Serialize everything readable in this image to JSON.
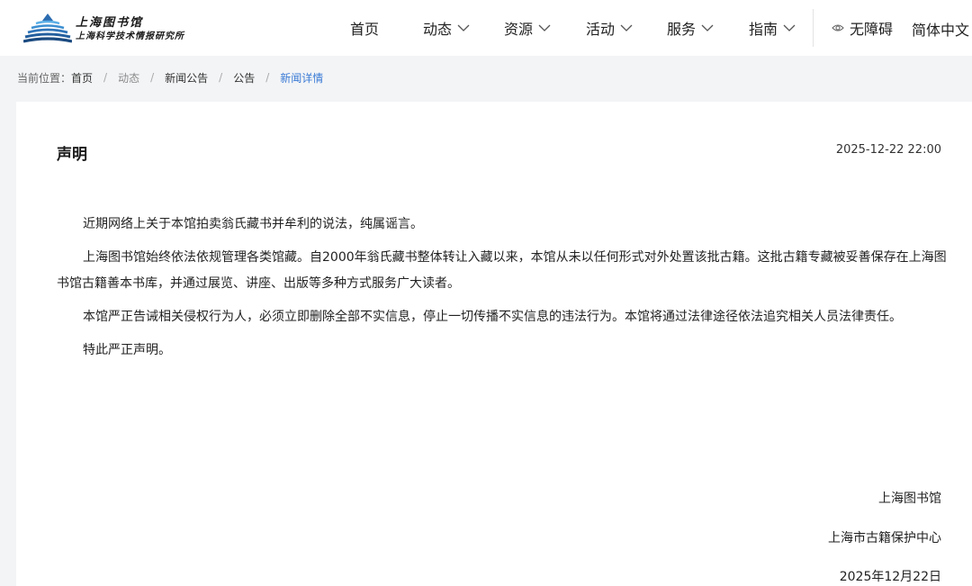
{
  "header": {
    "logo_name": "上海图书馆",
    "logo_subtitle": "上海科学技术情报研究所",
    "nav": [
      {
        "label": "首页",
        "has_dropdown": false
      },
      {
        "label": "动态",
        "has_dropdown": true
      },
      {
        "label": "资源",
        "has_dropdown": true
      },
      {
        "label": "活动",
        "has_dropdown": true
      },
      {
        "label": "服务",
        "has_dropdown": true
      },
      {
        "label": "指南",
        "has_dropdown": true
      }
    ],
    "accessibility_label": "无障碍",
    "language_label": "简体中文"
  },
  "breadcrumb": {
    "prefix": "当前位置：",
    "items": [
      "首页",
      "动态",
      "新闻公告",
      "公告",
      "新闻详情"
    ],
    "separator": "/"
  },
  "article": {
    "title": "声明",
    "datetime": "2025-12-22 22:00",
    "paragraphs": [
      "近期网络上关于本馆拍卖翁氏藏书并牟利的说法，纯属谣言。",
      "上海图书馆始终依法依规管理各类馆藏。自2000年翁氏藏书整体转让入藏以来，本馆从未以任何形式对外处置该批古籍。这批古籍专藏被妥善保存在上海图书馆古籍善本书库，并通过展览、讲座、出版等多种方式服务广大读者。",
      "本馆严正告诫相关侵权行为人，必须立即删除全部不实信息，停止一切传播不实信息的违法行为。本馆将通过法律途径依法追究相关人员法律责任。",
      "特此严正声明。"
    ],
    "signature": {
      "org1": "上海图书馆",
      "org2": "上海市古籍保护中心",
      "date": "2025年12月22日"
    }
  },
  "colors": {
    "accent": "#3a7bd5",
    "logo_blue_dark": "#1f4f8f",
    "logo_blue_light": "#4aa3df",
    "page_bg": "#f3f4f6"
  },
  "icons": {
    "chevron": "chevron-down-icon",
    "accessibility": "eye-icon",
    "logo": "library-logo-icon"
  }
}
